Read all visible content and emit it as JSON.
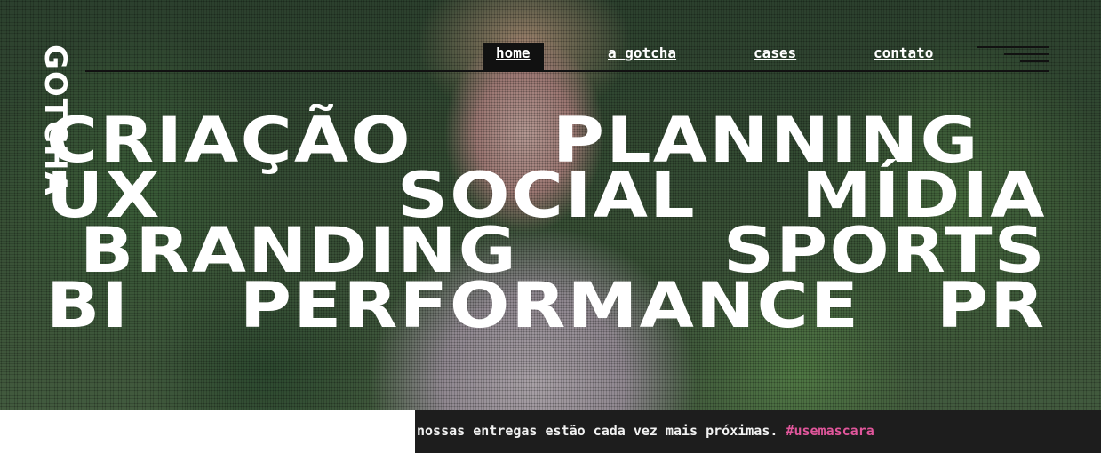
{
  "brand": {
    "logo_text": "GOTCHA"
  },
  "nav": {
    "items": [
      {
        "label": "home",
        "active": true
      },
      {
        "label": "a gotcha",
        "active": false
      },
      {
        "label": "cases",
        "active": false
      },
      {
        "label": "contato",
        "active": false
      }
    ],
    "menu_icon": "hamburger-icon"
  },
  "hero": {
    "rows": [
      [
        "CRIAÇÃO",
        "PLANNING"
      ],
      [
        "UX",
        "SOCIAL",
        "MÍDIA"
      ],
      [
        "BRANDING",
        "SPORTS"
      ],
      [
        "BI",
        "PERFORMANCE",
        "PR"
      ]
    ]
  },
  "ticker": {
    "text": "nossas entregas estão cada vez mais próximas. ",
    "hashtag": "#usemascara"
  },
  "colors": {
    "text": "#ffffff",
    "nav_active_bg": "#111111",
    "ticker_bg": "#1d1d1d",
    "hashtag": "#e0569b"
  }
}
